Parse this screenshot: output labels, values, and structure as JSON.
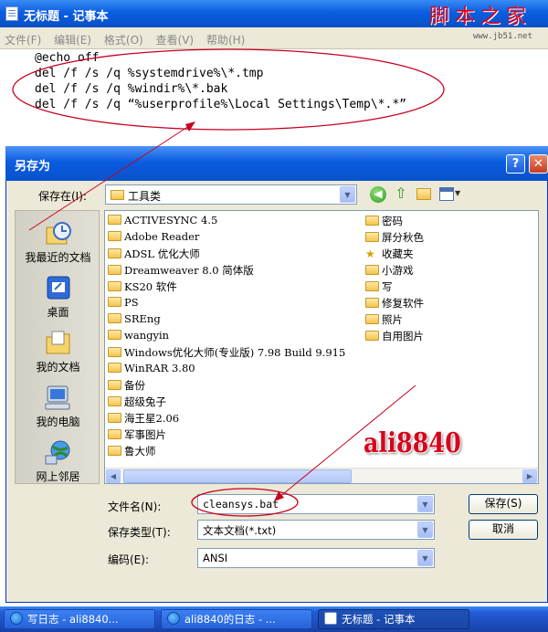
{
  "notepad": {
    "title": "无标题 - 记事本",
    "menu": [
      "文件(F)",
      "编辑(E)",
      "格式(O)",
      "查看(V)",
      "帮助(H)"
    ],
    "lines": [
      "@echo off",
      "del /f /s /q %systemdrive%\\*.tmp",
      "del /f /s /q %windir%\\*.bak",
      "del /f /s /q “%userprofile%\\Local Settings\\Temp\\*.*”"
    ]
  },
  "brand": {
    "name": "脚本之家",
    "url": "www.jb51.net"
  },
  "dialog": {
    "title": "另存为",
    "help_label": "?",
    "close_label": "✕",
    "save_in_label": "保存在(I):",
    "save_in_value": "工具类",
    "places": [
      "我最近的文档",
      "桌面",
      "我的文档",
      "我的电脑",
      "网上邻居"
    ],
    "files_col1": [
      "ACTIVESYNC 4.5",
      "Adobe Reader",
      "ADSL 优化大师",
      "Dreamweaver 8.0 简体版",
      "KS20 软件",
      "PS",
      "SREng",
      "wangyin",
      "Windows优化大师(专业版) 7.98 Build 9.915",
      "WinRAR 3.80",
      "备份",
      "超级兔子",
      "海王星2.06",
      "军事图片",
      "鲁大师"
    ],
    "files_col2": [
      "密码",
      "屏分秋色",
      "收藏夹",
      "小游戏",
      "写",
      "修复软件",
      "照片",
      "自用图片"
    ],
    "filename_label": "文件名(N):",
    "filename_value": "cleansys.bat",
    "type_label": "保存类型(T):",
    "type_value": "文本文档(*.txt)",
    "encoding_label": "编码(E):",
    "encoding_value": "ANSI",
    "save_button": "保存(S)",
    "cancel_button": "取消"
  },
  "watermark": "ali8840",
  "taskbar": {
    "tasks": [
      "写日志 - ali8840...",
      "ali8840的日志 - ...",
      "无标题 - 记事本"
    ]
  },
  "colors": {
    "titlebar": "#0a5ee0",
    "annotation": "#c8001e",
    "dialog_bg": "#ece9d8"
  }
}
